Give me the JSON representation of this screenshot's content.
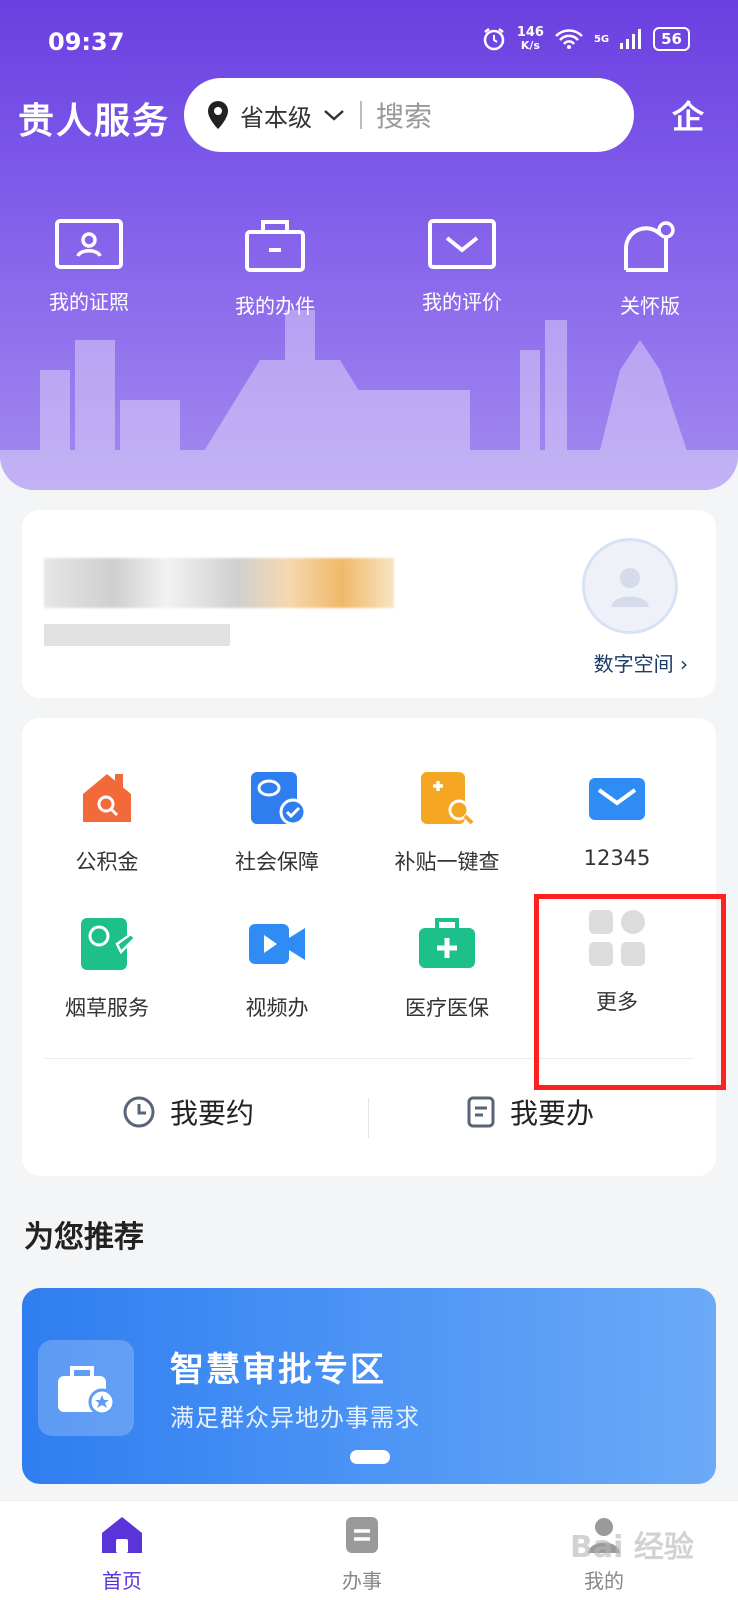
{
  "status": {
    "time": "09:37",
    "speed_value": "146",
    "speed_unit": "K/s",
    "network": "5G",
    "battery": "56"
  },
  "header": {
    "app_title": "贵人服务",
    "region": "省本级",
    "search_placeholder": "搜索",
    "corp_label": "企"
  },
  "quick_links": [
    {
      "label": "我的证照",
      "icon": "id-card-icon"
    },
    {
      "label": "我的办件",
      "icon": "briefcase-icon"
    },
    {
      "label": "我的评价",
      "icon": "mail-icon"
    },
    {
      "label": "关怀版",
      "icon": "care-icon"
    }
  ],
  "profile": {
    "digital_space": "数字空间 ›"
  },
  "services": [
    {
      "label": "公积金",
      "icon": "house-search-icon",
      "color": "#f26a3a"
    },
    {
      "label": "社会保障",
      "icon": "social-security-icon",
      "color": "#2f7ef0"
    },
    {
      "label": "补贴一键查",
      "icon": "subsidy-search-icon",
      "color": "#f5a623"
    },
    {
      "label": "12345",
      "icon": "mail-icon",
      "color": "#2f8cf5"
    },
    {
      "label": "烟草服务",
      "icon": "tobacco-icon",
      "color": "#1dbf8a"
    },
    {
      "label": "视频办",
      "icon": "video-icon",
      "color": "#2f8cf5"
    },
    {
      "label": "医疗医保",
      "icon": "medical-kit-icon",
      "color": "#1dbf8a"
    },
    {
      "label": "更多",
      "icon": "grid-more-icon",
      "color": "#d9d9d9"
    }
  ],
  "actions": {
    "appointment": "我要约",
    "handle": "我要办"
  },
  "recommend": {
    "title": "为您推荐",
    "banner_title": "智慧审批专区",
    "banner_subtitle": "满足群众异地办事需求"
  },
  "nav": [
    {
      "label": "首页",
      "active": true
    },
    {
      "label": "办事",
      "active": false
    },
    {
      "label": "我的",
      "active": false
    }
  ],
  "watermark": "Bai 经验"
}
